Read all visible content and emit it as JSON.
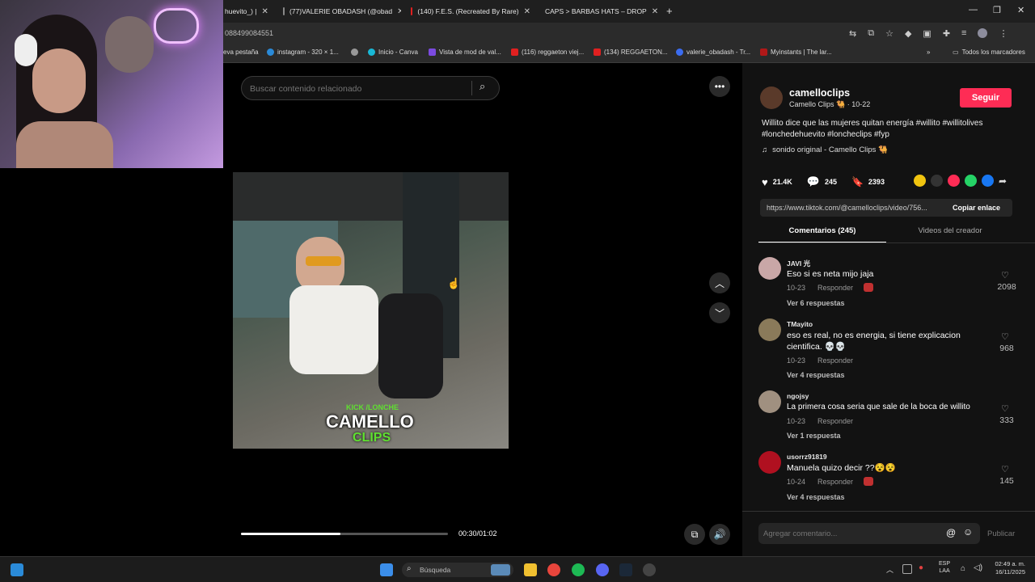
{
  "browser": {
    "tabs": [
      {
        "label": "huevito_) |"
      },
      {
        "label": "(77)VALERIE OBADASH (@obad"
      },
      {
        "label": "(140) F.E.S. (Recreated By Rare)"
      },
      {
        "label": "CAPS > BARBAS HATS – DROP"
      }
    ],
    "address": "088499084551",
    "bookmarks": [
      {
        "label": "eva pestaña"
      },
      {
        "label": "instagram - 320 × 1..."
      },
      {
        "label": "Inicio - Canva"
      },
      {
        "label": "Vista de mod de val..."
      },
      {
        "label": "(116) reggaeton viej..."
      },
      {
        "label": "(134) REGGAETON..."
      },
      {
        "label": "valerie_obadash - Tr..."
      },
      {
        "label": "Myinstants | The lar..."
      }
    ],
    "all_bookmarks": "Todos los marcadores"
  },
  "search": {
    "placeholder": "Buscar contenido relacionado"
  },
  "video": {
    "overlay_top": "KICK /LONCHE",
    "overlay_mid": "CAMELLO",
    "overlay_bot": "CLIPS",
    "time": "00:30/01:02",
    "progress": 0.48
  },
  "creator": {
    "username": "camelloclips",
    "display": "Camello Clips 🐫 · 10-22",
    "follow": "Seguir",
    "description": "Willito dice que las mujeres quitan energía #willito #willitolives #lonchedehuevito #loncheclips #fyp",
    "sound": "sonido original - Camello Clips 🐫"
  },
  "stats": {
    "likes": "21.4K",
    "comments": "245",
    "saves": "2393"
  },
  "link": {
    "url": "https://www.tiktok.com/@camelloclips/video/756...",
    "copy": "Copiar enlace"
  },
  "tabs": {
    "comments": "Comentarios (245)",
    "creator_videos": "Videos del creador"
  },
  "comments": [
    {
      "name": "JAVI 光",
      "text": "Eso si es neta mijo jaja",
      "date": "10-23",
      "reply": "Responder",
      "more": "Ver 6 respuestas",
      "likes": "2098",
      "avatar": "#c9a7a7"
    },
    {
      "name": "TMayito",
      "text": "eso es real, no es energia, si tiene explicacion cientifica. 💀💀",
      "date": "10-23",
      "reply": "Responder",
      "more": "Ver 4 respuestas",
      "likes": "968",
      "avatar": "#8a7a5a"
    },
    {
      "name": "ngojsy",
      "text": "La primera cosa seria que sale de la boca de willito",
      "date": "10-23",
      "reply": "Responder",
      "more": "Ver 1 respuesta",
      "likes": "333",
      "avatar": "#a09080"
    },
    {
      "name": "usorrz91819",
      "text": "Manuela quizo decir ??😵😵",
      "date": "10-24",
      "reply": "Responder",
      "more": "Ver 4 respuestas",
      "likes": "145",
      "avatar": "#b01020"
    }
  ],
  "comment_input": {
    "placeholder": "Agregar comentario...",
    "publish": "Publicar"
  },
  "taskbar": {
    "search": "Búsqueda",
    "lang1": "ESP",
    "lang2": "LAA",
    "time": "02:49 a. m.",
    "date": "16/11/2025"
  }
}
